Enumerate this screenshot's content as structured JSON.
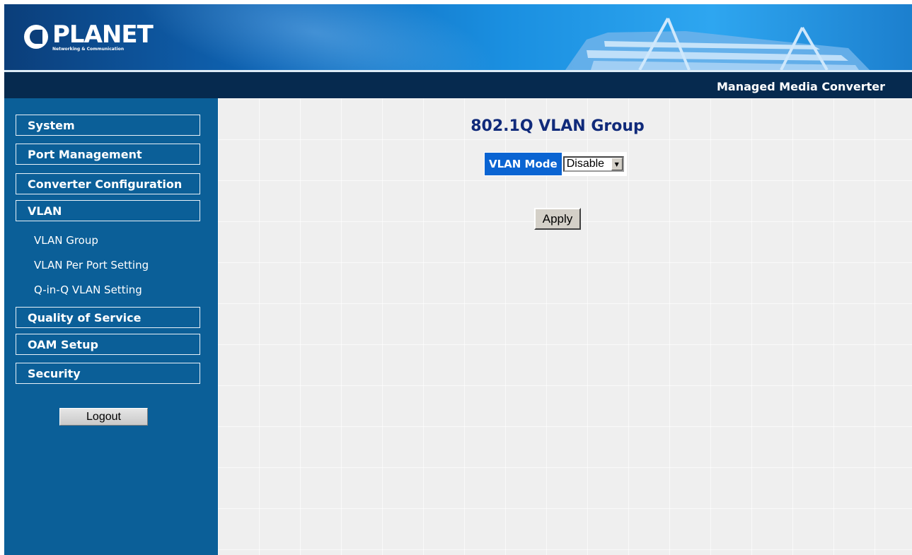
{
  "header": {
    "brand": "PLANET",
    "tagline": "Networking & Communication",
    "product_title": "Managed Media Converter"
  },
  "sidebar": {
    "items": [
      {
        "label": "System"
      },
      {
        "label": "Port Management"
      },
      {
        "label": "Converter Configuration"
      },
      {
        "label": "VLAN"
      },
      {
        "label": "Quality of Service"
      },
      {
        "label": "OAM Setup"
      },
      {
        "label": "Security"
      }
    ],
    "vlan_subitems": [
      {
        "label": "VLAN Group"
      },
      {
        "label": "VLAN Per Port Setting"
      },
      {
        "label": "Q-in-Q VLAN Setting"
      }
    ],
    "logout_label": "Logout"
  },
  "main": {
    "title": "802.1Q VLAN Group",
    "vlan_mode_label": "VLAN Mode",
    "vlan_mode_value": "Disable",
    "apply_label": "Apply"
  },
  "colors": {
    "sidebar_bg": "#0b5f98",
    "title_bar_bg": "#062a4f",
    "page_title": "#102a7a",
    "mode_label_bg": "#0a64d2",
    "content_bg": "#efefef"
  },
  "icons": {
    "logo": "planet-logo-icon",
    "dropdown": "dropdown-arrow-icon"
  }
}
